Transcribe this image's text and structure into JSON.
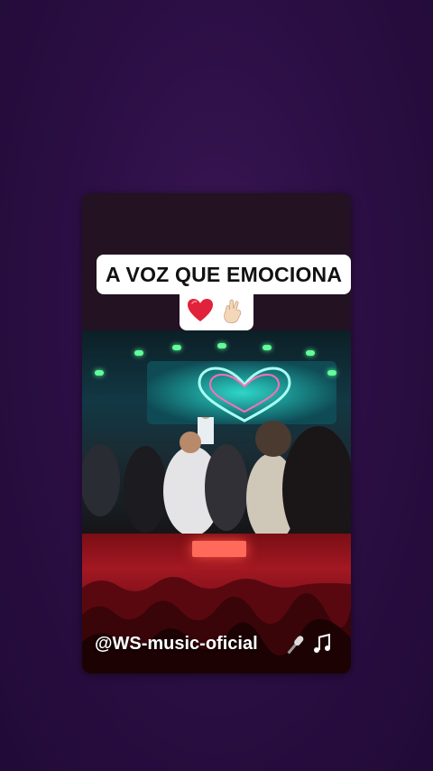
{
  "story": {
    "caption_line1": "A VOZ QUE EMOCIONA",
    "caption_emojis": [
      "heart-emoji",
      "fingers-crossed-emoji"
    ],
    "watermark": "@WS-music-oficial"
  },
  "colors": {
    "background": "#2c0f45",
    "caption_bg": "#ffffff",
    "caption_text": "#111111",
    "heart": "#e0233a"
  }
}
